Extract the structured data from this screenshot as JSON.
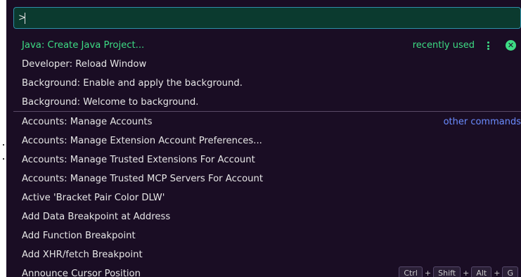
{
  "command_palette": {
    "input_value": ">",
    "items": [
      {
        "label": "Java: Create Java Project...",
        "tag": "recently used"
      },
      {
        "label": "Developer: Reload Window"
      },
      {
        "label": "Background: Enable and apply the background."
      },
      {
        "label": "Background: Welcome to background."
      },
      {
        "label": "Accounts: Manage Accounts",
        "tag": "other commands"
      },
      {
        "label": "Accounts: Manage Extension Account Preferences..."
      },
      {
        "label": "Accounts: Manage Trusted Extensions For Account"
      },
      {
        "label": "Accounts: Manage Trusted MCP Servers For Account"
      },
      {
        "label": "Active 'Bracket Pair Color DLW'"
      },
      {
        "label": "Add Data Breakpoint at Address"
      },
      {
        "label": "Add Function Breakpoint"
      },
      {
        "label": "Add XHR/fetch Breakpoint"
      },
      {
        "label": "Announce Cursor Position",
        "keybinding": [
          "Ctrl",
          "Shift",
          "Alt",
          "G"
        ]
      }
    ],
    "keybinding_separator": "+",
    "icons": {
      "more": "kebab-menu-icon",
      "remove": "close-circle-icon"
    },
    "colors": {
      "background": "#1a0d24",
      "input_background": "#0b3a2f",
      "input_border": "#2f8fa8",
      "highlight_text": "#3ddc84",
      "group_label": "#6b8cff",
      "text": "#e6e6e6"
    }
  }
}
